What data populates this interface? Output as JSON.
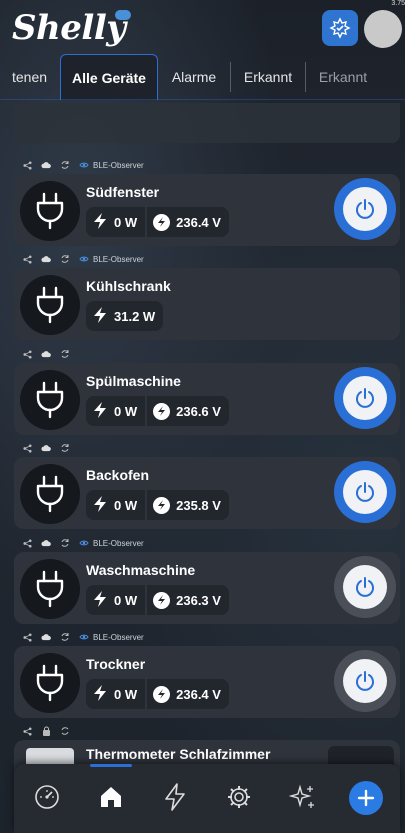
{
  "header": {
    "logo": "Shelly",
    "status_corner": "3.75"
  },
  "tabs": [
    {
      "label": "tenen"
    },
    {
      "label": "Alle Geräte"
    },
    {
      "label": "Alarme"
    },
    {
      "label": "Erkannt"
    },
    {
      "label": "Erkannt"
    }
  ],
  "devices": [
    {
      "name": "Südfenster",
      "ble": "BLE-Observer",
      "power": "0 W",
      "voltage": "236.4 V",
      "state": "on"
    },
    {
      "name": "Kühlschrank",
      "ble": "BLE-Observer",
      "power": "31.2 W",
      "voltage": "",
      "state": "none"
    },
    {
      "name": "Spülmaschine",
      "ble": "",
      "power": "0 W",
      "voltage": "236.6 V",
      "state": "on"
    },
    {
      "name": "Backofen",
      "ble": "",
      "power": "0 W",
      "voltage": "235.8 V",
      "state": "on"
    },
    {
      "name": "Waschmaschine",
      "ble": "BLE-Observer",
      "power": "0 W",
      "voltage": "236.3 V",
      "state": "off"
    },
    {
      "name": "Trockner",
      "ble": "BLE-Observer",
      "power": "0 W",
      "voltage": "236.4 V",
      "state": "off"
    }
  ],
  "partial_device": {
    "name": "Thermometer Schlafzimmer"
  },
  "bottom_nav": [
    "gauge-icon",
    "home-icon",
    "bolt-icon",
    "gear-icon",
    "sparkles-icon",
    "add-icon"
  ],
  "colors": {
    "accent": "#2a6fd6",
    "card": "#2f343c",
    "background": "#1e232b"
  }
}
